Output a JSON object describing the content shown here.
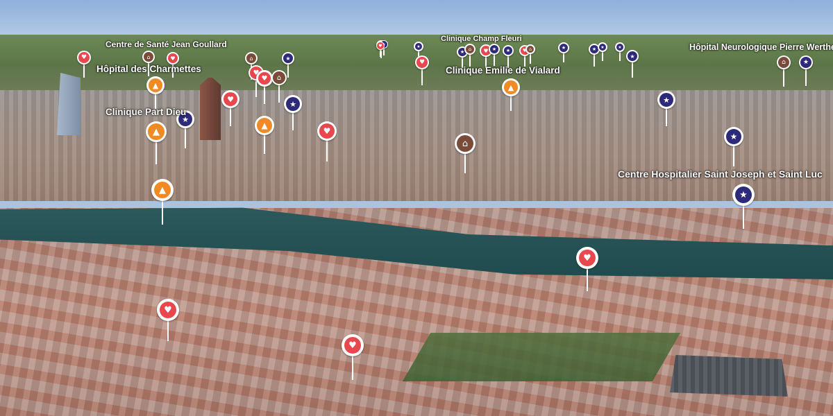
{
  "colors": {
    "hospital": "#e8484d",
    "police": "#2e2a7a",
    "fire": "#f08a24",
    "government": "#7b4b3a"
  },
  "labels": [
    {
      "text": "Centre de Santé Jean Goullard"
    },
    {
      "text": "Hôpital des Charmettes"
    },
    {
      "text": "Clinique Part Dieu"
    },
    {
      "text": "Clinique Champ Fleuri"
    },
    {
      "text": "Clinique Emilie de Vialard"
    },
    {
      "text": "Hôpital Neurologique Pierre Wertheimer"
    },
    {
      "text": "Centre Hospitalier Saint Joseph et Saint Luc"
    }
  ],
  "pois": [
    {
      "type": "hospital",
      "icon": "heartbeat-icon"
    },
    {
      "type": "government",
      "icon": "building-icon"
    },
    {
      "type": "hospital",
      "icon": "heartbeat-icon"
    },
    {
      "type": "government",
      "icon": "building-icon"
    },
    {
      "type": "police",
      "icon": "police-star-icon"
    },
    {
      "type": "government",
      "icon": "building-icon"
    },
    {
      "type": "police",
      "icon": "police-star-icon"
    },
    {
      "type": "police",
      "icon": "police-star-icon"
    },
    {
      "type": "government",
      "icon": "building-icon"
    },
    {
      "type": "hospital",
      "icon": "heartbeat-icon"
    },
    {
      "type": "police",
      "icon": "police-star-icon"
    },
    {
      "type": "police",
      "icon": "police-star-icon"
    },
    {
      "type": "hospital",
      "icon": "heartbeat-icon"
    },
    {
      "type": "government",
      "icon": "building-icon"
    },
    {
      "type": "police",
      "icon": "police-star-icon"
    },
    {
      "type": "police",
      "icon": "police-star-icon"
    },
    {
      "type": "police",
      "icon": "police-star-icon"
    },
    {
      "type": "police",
      "icon": "police-star-icon"
    },
    {
      "type": "police",
      "icon": "police-star-icon"
    },
    {
      "type": "government",
      "icon": "building-icon"
    },
    {
      "type": "police",
      "icon": "police-star-icon"
    },
    {
      "type": "fire",
      "icon": "fire-icon"
    },
    {
      "type": "fire",
      "icon": "fire-icon"
    },
    {
      "type": "police",
      "icon": "police-star-icon"
    },
    {
      "type": "hospital",
      "icon": "heartbeat-icon"
    },
    {
      "type": "hospital",
      "icon": "heartbeat-icon"
    },
    {
      "type": "hospital",
      "icon": "heartbeat-icon"
    },
    {
      "type": "government",
      "icon": "building-icon"
    },
    {
      "type": "police",
      "icon": "police-star-icon"
    },
    {
      "type": "fire",
      "icon": "fire-icon"
    },
    {
      "type": "hospital",
      "icon": "heartbeat-icon"
    },
    {
      "type": "hospital",
      "icon": "heartbeat-icon"
    },
    {
      "type": "fire",
      "icon": "fire-icon"
    },
    {
      "type": "police",
      "icon": "police-star-icon"
    },
    {
      "type": "police",
      "icon": "police-star-icon"
    },
    {
      "type": "government",
      "icon": "building-icon"
    },
    {
      "type": "police",
      "icon": "police-star-icon"
    },
    {
      "type": "fire",
      "icon": "fire-icon"
    },
    {
      "type": "hospital",
      "icon": "heartbeat-icon"
    },
    {
      "type": "hospital",
      "icon": "heartbeat-icon"
    },
    {
      "type": "hospital",
      "icon": "heartbeat-icon"
    },
    {
      "type": "police",
      "icon": "police-star-icon"
    },
    {
      "type": "hospital",
      "icon": "heartbeat-icon"
    }
  ]
}
